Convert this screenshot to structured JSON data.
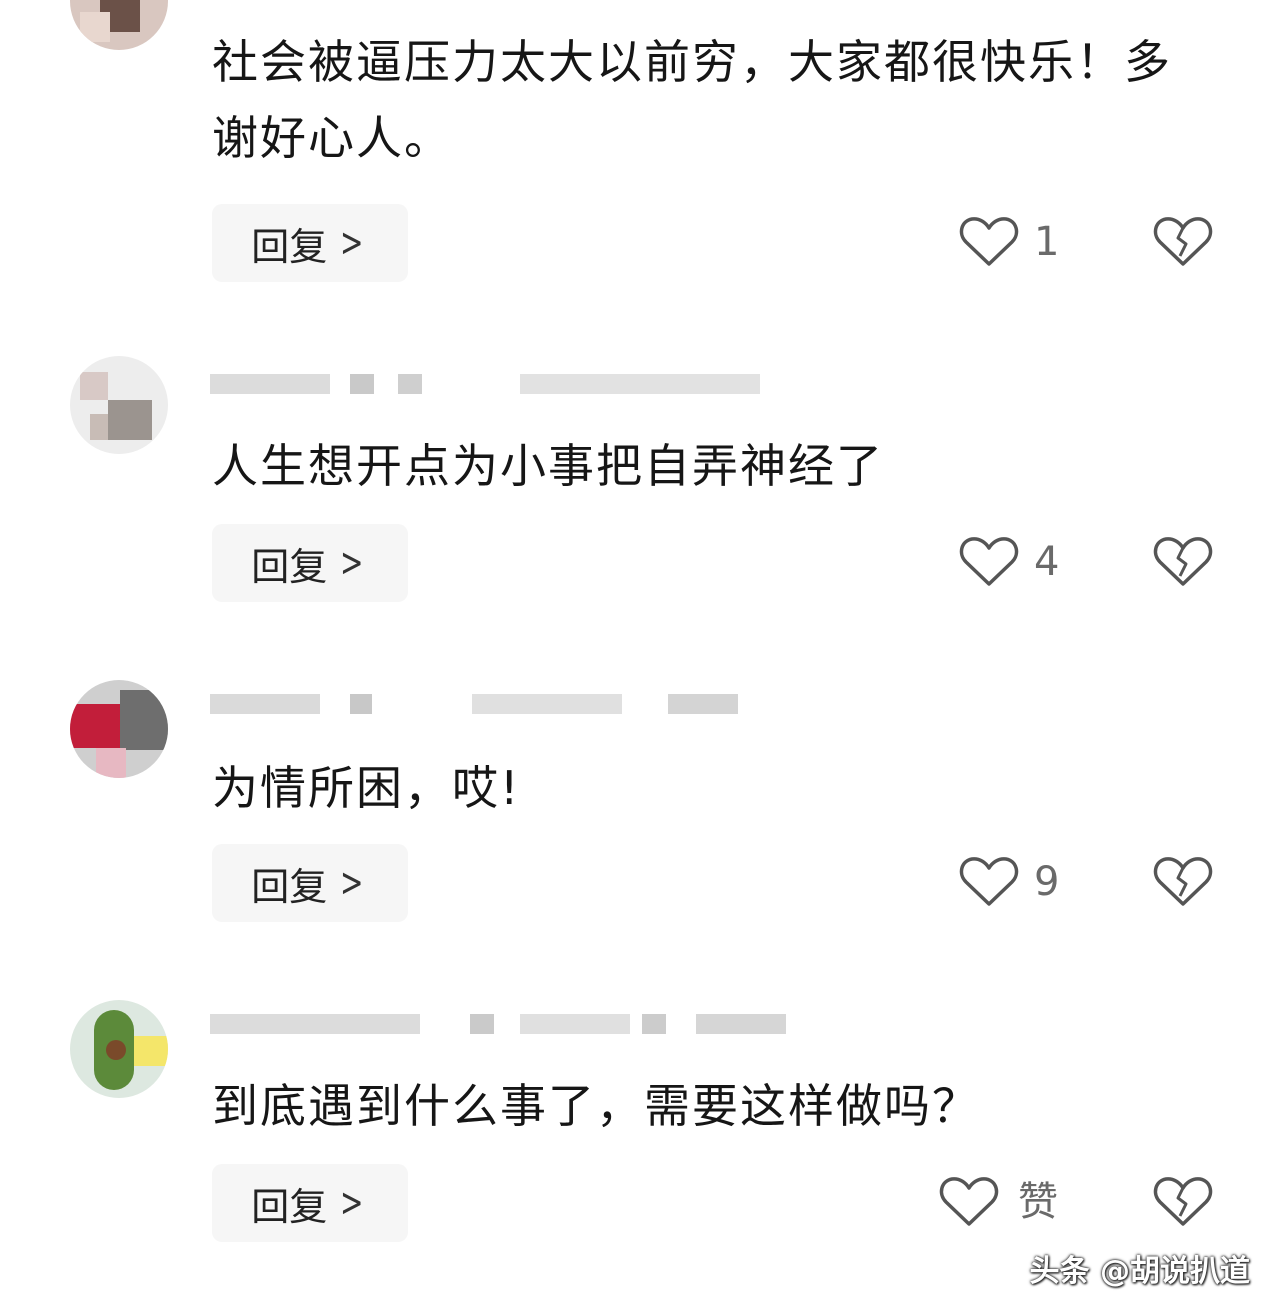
{
  "comments": [
    {
      "text": "社会被逼压力太大以前穷，大家都很快乐！多谢好心人。",
      "reply_label": "回复",
      "like_count": "1"
    },
    {
      "text": "人生想开点为小事把自弄神经了",
      "reply_label": "回复",
      "like_count": "4"
    },
    {
      "text": "为情所困，哎!",
      "reply_label": "回复",
      "like_count": "9"
    },
    {
      "text": "到底遇到什么事了，需要这样做吗？",
      "reply_label": "回复",
      "like_count": "赞"
    }
  ],
  "icons": {
    "like": "heart-outline-icon",
    "dislike": "broken-heart-icon",
    "reply_arrow": "chevron-right-icon"
  },
  "watermark": "头条 @胡说扒道",
  "colors": {
    "background": "#ffffff",
    "text": "#161616",
    "reply_bg": "#f6f6f6",
    "icon": "#555555"
  }
}
